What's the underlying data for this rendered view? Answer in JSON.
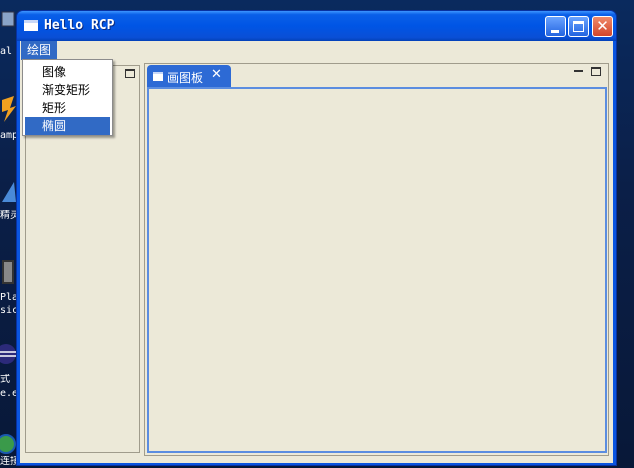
{
  "desktop": {
    "icons": [
      {
        "label": "al I",
        "icon": "app-icon"
      },
      {
        "label": "amp",
        "icon": "winamp-icon"
      },
      {
        "label": "精灵",
        "icon": "wizard-icon"
      },
      {
        "label": "Play",
        "icon": "media-icon"
      },
      {
        "label": "sic",
        "icon": "media-icon"
      },
      {
        "label": "式",
        "icon": "eclipse-icon"
      },
      {
        "label": "e.e",
        "icon": "eclipse-icon"
      },
      {
        "label": "连接",
        "icon": "network-icon"
      }
    ]
  },
  "window": {
    "title": "Hello RCP",
    "buttons": {
      "minimize": "minimize-icon",
      "maximize": "maximize-icon",
      "close": "✕"
    }
  },
  "menubar": {
    "menus": [
      {
        "label": "绘图"
      }
    ]
  },
  "dropdown": {
    "items": [
      {
        "label": "图像",
        "selected": false
      },
      {
        "label": "渐变矩形",
        "selected": false
      },
      {
        "label": "矩形",
        "selected": false
      },
      {
        "label": "椭圆",
        "selected": true
      }
    ]
  },
  "editor": {
    "tab": {
      "label": "画图板",
      "close": "✕"
    }
  },
  "colors": {
    "titlebar": "#0055e5",
    "selection": "#316ac5",
    "client": "#ece9d8",
    "canvas_border": "#5b8de0"
  }
}
